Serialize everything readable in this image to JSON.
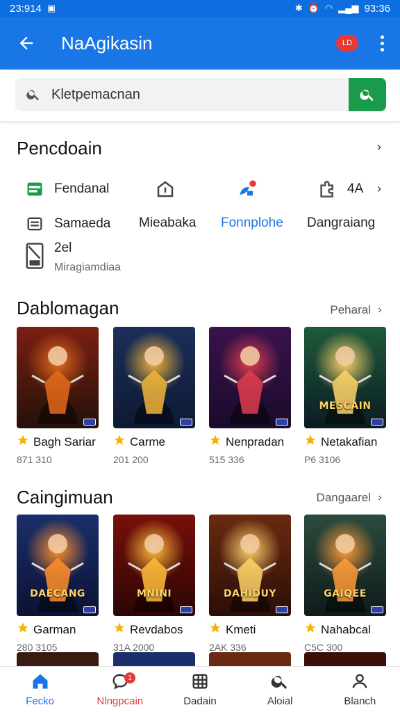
{
  "status_bar": {
    "time_left": "23:914",
    "time_right": "93:36"
  },
  "app_bar": {
    "title": "NaAgikasin",
    "badge": "LD"
  },
  "search": {
    "placeholder": "Kletpemacnan"
  },
  "section_categories": {
    "title": "Pencdoain"
  },
  "categories": [
    {
      "label": "Fendanal",
      "icon": "calendar-icon"
    },
    {
      "label": "Mieabaka",
      "icon": "dock-icon"
    },
    {
      "label": "Fonnplohe",
      "icon": "fan-icon",
      "color": "#1976e6"
    },
    {
      "label": "Dangraiang",
      "icon": "puzzle-icon"
    },
    {
      "label": "Samaeda",
      "icon": "list-icon"
    },
    {
      "label": "2el",
      "icon": "folder-icon"
    },
    {
      "label": "Miragiamdiaa",
      "icon": "folder-icon"
    }
  ],
  "counts": {
    "top_right": "4A"
  },
  "section_popular": {
    "title": "Dablomagan",
    "more": "Peharal"
  },
  "popular": [
    {
      "title": "Bagh Sariar",
      "sub": "871 310",
      "color_top": "#7b1f12",
      "color_bottom": "#23110a",
      "accent": "#e36a1b",
      "caption": ""
    },
    {
      "title": "Carme",
      "sub": "201 200",
      "color_top": "#1c2e59",
      "color_bottom": "#0d1a33",
      "accent": "#f2b53a",
      "caption": ""
    },
    {
      "title": "Nenpradan",
      "sub": "515 336",
      "color_top": "#3a124d",
      "color_bottom": "#1a0b2a",
      "accent": "#e03c4f",
      "caption": ""
    },
    {
      "title": "Netakafian",
      "sub": "P6 3106",
      "color_top": "#1f5a3b",
      "color_bottom": "#0b1c22",
      "accent": "#ffd36a",
      "caption": "MESCAIN"
    }
  ],
  "section_new": {
    "title": "Caingimuan",
    "more": "Dangaarel"
  },
  "new": [
    {
      "title": "Garman",
      "sub": "280 3105",
      "color_top": "#1b2f6b",
      "color_bottom": "#0b1334",
      "accent": "#ff8f2a",
      "caption": "DAECANG"
    },
    {
      "title": "Revdabos",
      "sub": "31A 2000",
      "color_top": "#7a0f0a",
      "color_bottom": "#2a0605",
      "accent": "#ffbd3a",
      "caption": "MNINI"
    },
    {
      "title": "Kmeti",
      "sub": "2AK 336",
      "color_top": "#6a2a11",
      "color_bottom": "#2b0e07",
      "accent": "#ffd36a",
      "caption": "DAHIDUY"
    },
    {
      "title": "Nahabcal",
      "sub": "C5C 300",
      "color_top": "#2b4b3d",
      "color_bottom": "#0e1c1b",
      "accent": "#ff9b3a",
      "caption": "GAIQEE"
    }
  ],
  "bottom_nav": [
    {
      "label": "Fecko",
      "icon": "home-icon",
      "state": "active"
    },
    {
      "label": "Nlngpcain",
      "icon": "chat-icon",
      "state": "red",
      "badge": "1"
    },
    {
      "label": "Dadain",
      "icon": "grid-icon"
    },
    {
      "label": "Aloial",
      "icon": "search-icon"
    },
    {
      "label": "Blanch",
      "icon": "profile-icon"
    }
  ]
}
